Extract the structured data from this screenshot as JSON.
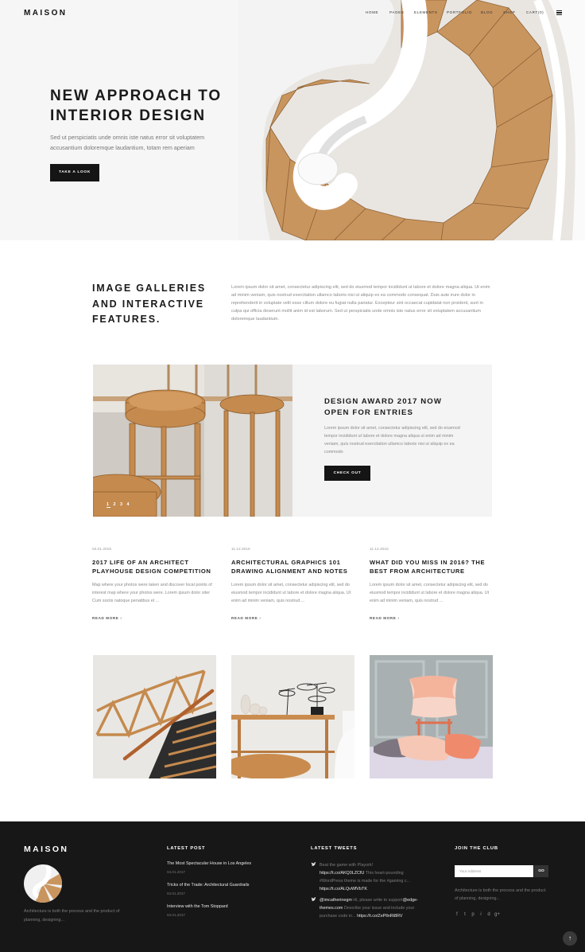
{
  "header": {
    "logo": "MAISON",
    "nav": [
      "HOME",
      "PAGES",
      "ELEMENTS",
      "PORTFOLIO",
      "BLOG",
      "SHOP",
      "CART(0)"
    ]
  },
  "hero": {
    "title": "NEW APPROACH TO INTERIOR DESIGN",
    "text": "Sed ut perspiciatis unde omnis iste natus error sit voluptatem accusantium doloremque laudantium, totam rem aperiam",
    "button": "TAKE A LOOK"
  },
  "features": {
    "title": "IMAGE GALLERIES AND INTERACTIVE FEATURES.",
    "text": "Lorem ipsum dolor sit amet, consectetur adipiscing elit, sed do eiusmod tempor incididunt ut labore et dolore magna aliqua. Ut enim ad minim veniam, quis nostrud exercitation ullamco laboris nisi ut aliquip ex ea commodo consequat. Duis aute irure dolor in reprehenderit in voluptate velit esse cillum dolore eu fugiat nulla pariatur. Excepteur sint occaecat cupidatat non proident, sunt in culpa qui officia deserunt mollit anim id est laborum. Sed ut perspiciatis unde omnis iste natus error sit voluptatem accusantium doloremque laudantium."
  },
  "award": {
    "title": "DESIGN AWARD 2017 NOW OPEN FOR ENTRIES",
    "text": "Lorem ipsum dolor sit amet, consectetur adipiscing elit, sed do eiusmod tempor incididunt ut labore et dolore magna aliqua ut enim ad minim veniam, quis nostrud exercitation ullamco laboris nisi ut aliquip ex ea commodo",
    "button": "CHECK OUT",
    "pager": [
      "1",
      "2",
      "3",
      "4"
    ]
  },
  "posts": [
    {
      "date": "04.01.2016",
      "title": "2017 LIFE OF AN ARCHITECT PLAYHOUSE DESIGN COMPETITION",
      "text": "Map where your photos were taken and discover local points of interest map where your photos were. Lorem ipsum dolor siter Cum sociis natoque penatibus et ...",
      "more": "READ MORE ›"
    },
    {
      "date": "11.12.2015",
      "title": "ARCHITECTURAL GRAPHICS 101 DRAWING ALIGNMENT AND NOTES",
      "text": "Lorem ipsum dolor sit amet, consectetur adipiscing elit, sed do eiusmod tempor incididunt ut labore et dolore magna aliqua. Ut enim ad minim veniam, quis nostrud ...",
      "more": "READ MORE ›"
    },
    {
      "date": "11.12.2015",
      "title": "WHAT DID YOU MISS IN 2016? THE BEST FROM ARCHITECTURE",
      "text": "Lorem ipsum dolor sit amet, consectetur adipiscing elit, sed do eiusmod tempor incididunt ut labore et dolore magna aliqua. Ut enim ad minim veniam, quis nostrud ...",
      "more": "READ MORE ›"
    }
  ],
  "footer": {
    "logo": "MAISON",
    "about": "Architecture is both the process and the product of planning, designing...",
    "latest_post_heading": "LATEST POST",
    "latest_posts": [
      {
        "title": "The Most Spectacular House in Los Angeles",
        "date": "04.01.2017"
      },
      {
        "title": "Tricks of the Trade: Architectural Guardrails",
        "date": "04.01.2017"
      },
      {
        "title": "Interview with the Tom Stoppard",
        "date": "04.01.2017"
      }
    ],
    "tweets_heading": "LATEST TWEETS",
    "tweet1": {
      "a": "Beat the game with Playork!",
      "b": "https://t.co/AKQ0LZCfU",
      "c": "This heart-pounding #WordPress theme is made for the #gaming c...",
      "d": "https://t.co/ALQvWfVbTK"
    },
    "tweet2": {
      "a": "@imcatherinegm",
      "b": "Hi, please write to support",
      "c": "@edge-themes.com",
      "d": "Describe your issue and include your purchase code in...",
      "e": "https://t.co/ZePllnRt8RV"
    },
    "join_heading": "JOIN THE CLUB",
    "join_placeholder": "Your Address",
    "join_button": "GO",
    "join_text": "Architecture is both the process and the product of planning, designing...",
    "socials": [
      "f",
      "t",
      "p",
      "i",
      "d",
      "g+"
    ]
  },
  "colors": {
    "footer_bg": "#171717",
    "button_bg": "#151515",
    "panel_bg": "#f4f4f4",
    "wood": "#c9955e"
  }
}
